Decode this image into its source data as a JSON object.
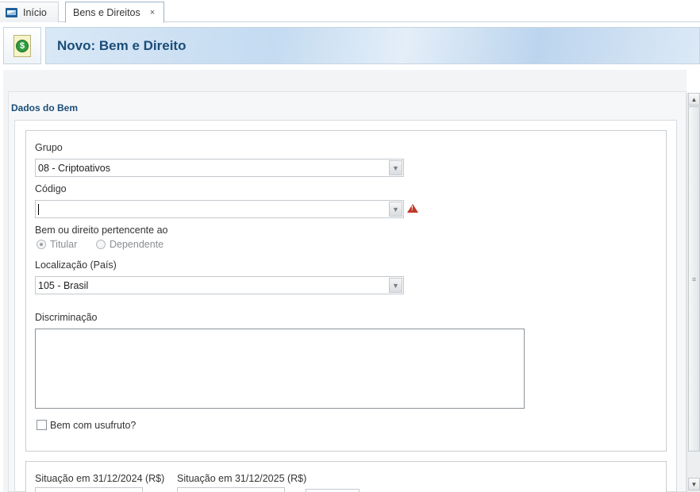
{
  "tabs": {
    "home_label": "Início",
    "active_label": "Bens e Direitos",
    "close_symbol": "×"
  },
  "header": {
    "title": "Novo: Bem e Direito",
    "icon": "document-money-icon"
  },
  "section": {
    "title": "Dados do Bem"
  },
  "form": {
    "grupo_label": "Grupo",
    "grupo_value": "08 - Criptoativos",
    "codigo_label": "Código",
    "codigo_value": "",
    "pertencente_label": "Bem ou direito pertencente ao",
    "titular_label": "Titular",
    "dependente_label": "Dependente",
    "localizacao_label": "Localização (País)",
    "localizacao_value": "105 - Brasil",
    "discriminacao_label": "Discriminação",
    "discriminacao_value": "",
    "usufruto_label": "Bem com usufruto?",
    "situacao_2024_label": "Situação em 31/12/2024 (R$)",
    "situacao_2025_label": "Situação em 31/12/2025 (R$)"
  },
  "colors": {
    "title_blue": "#1b4d78",
    "warning_red": "#c0392b"
  }
}
